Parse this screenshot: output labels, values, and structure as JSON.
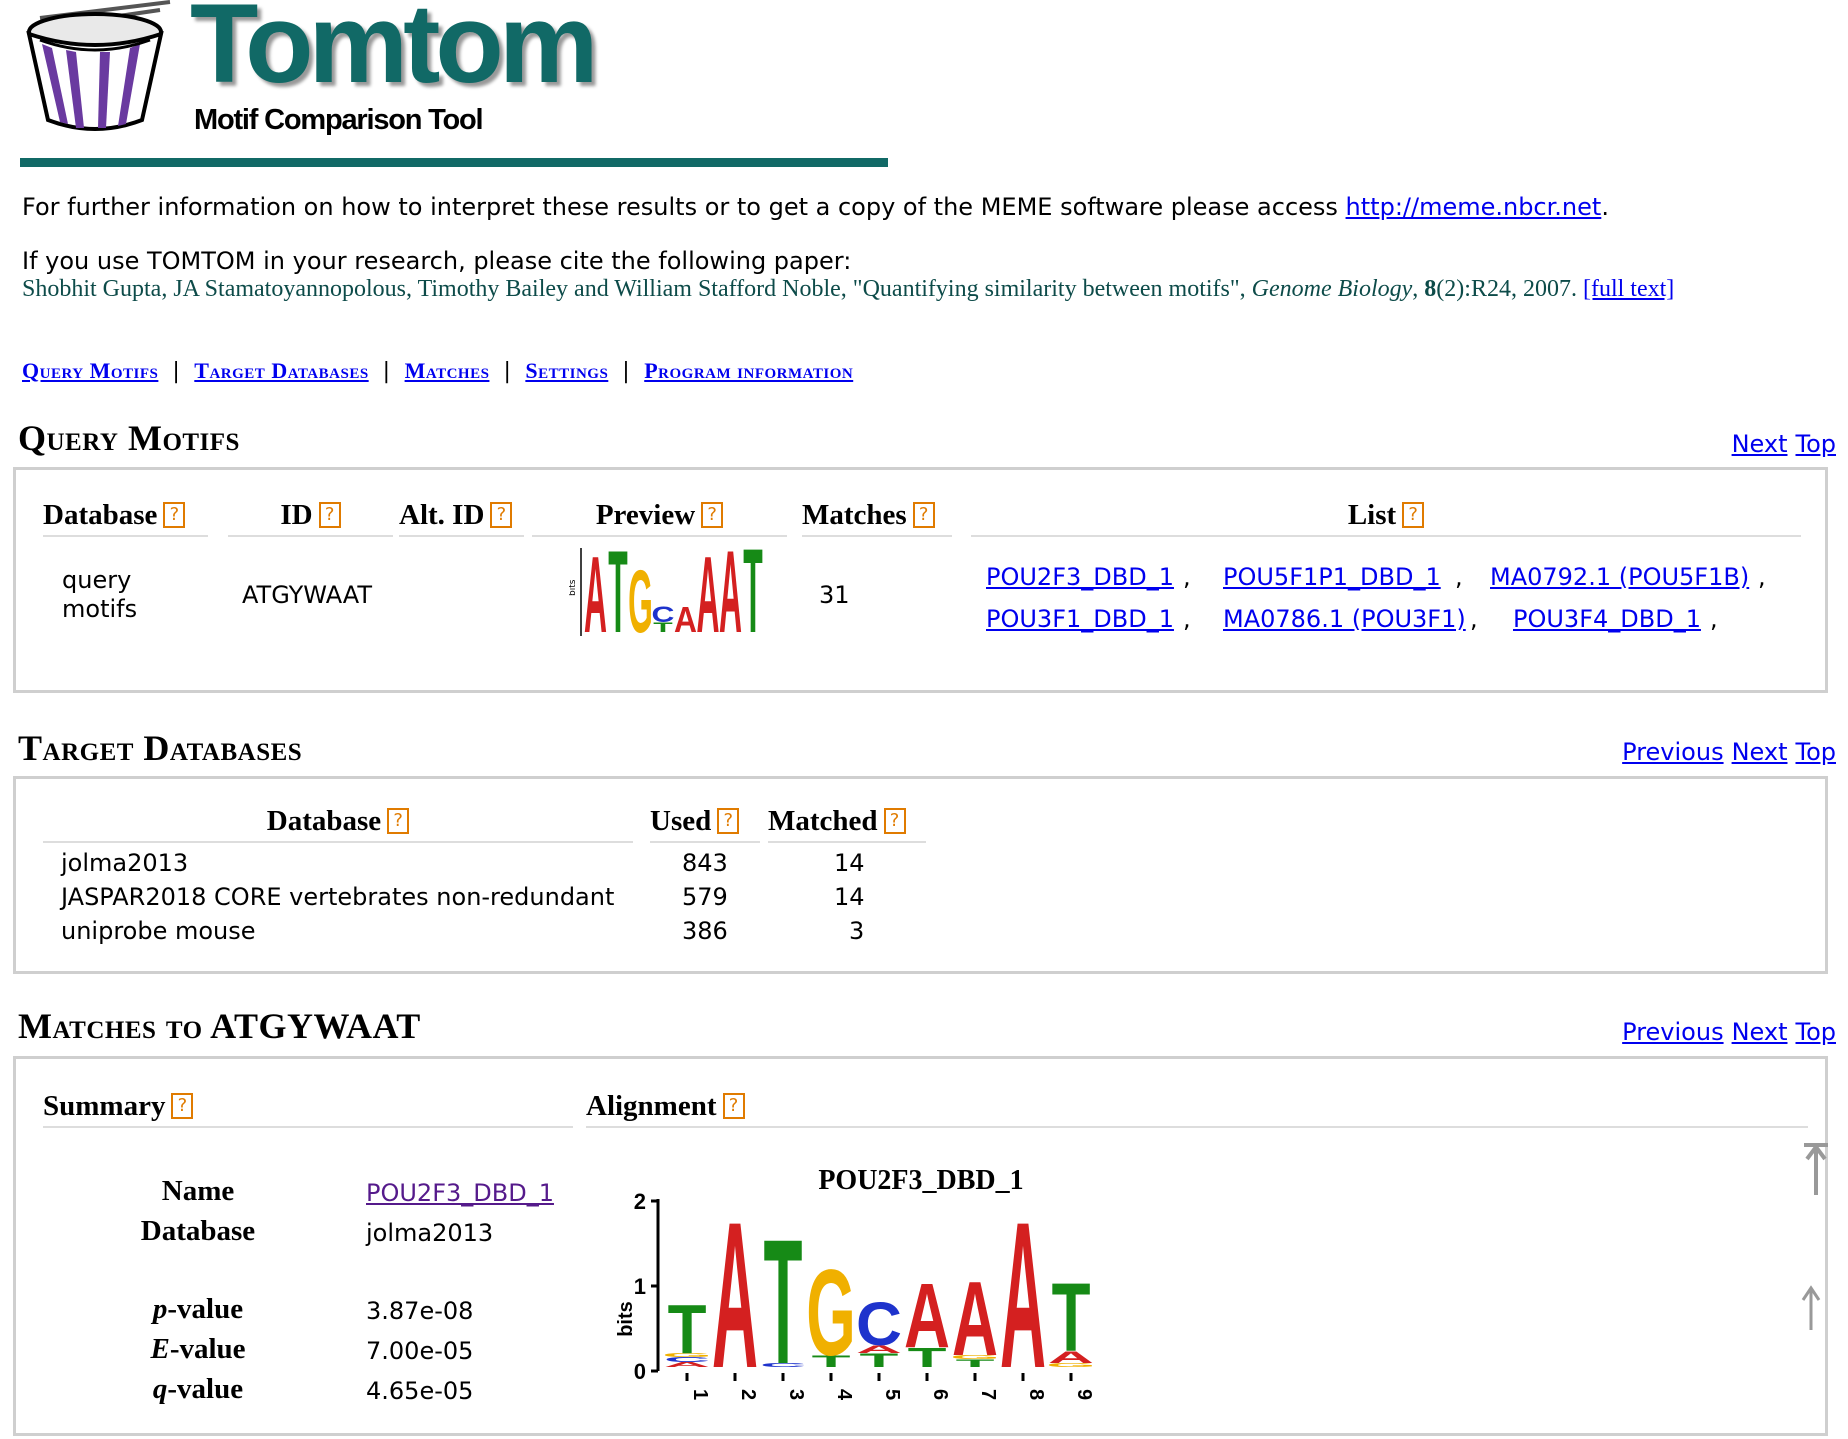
{
  "header": {
    "title": "Tomtom",
    "subtitle": "Motif Comparison Tool"
  },
  "intro": {
    "info_text": "For further information on how to interpret these results or to get a copy of the MEME software please access ",
    "info_link": "http://meme.nbcr.net",
    "info_end": ".",
    "cite_text": "If you use TOMTOM in your research, please cite the following paper:",
    "citation": {
      "authors": "Shobhit Gupta, JA Stamatoyannopolous, Timothy Bailey and William Stafford Noble, \"Quantifying similarity between motifs\", ",
      "journal": "Genome Biology",
      "sep": ", ",
      "volume": "8",
      "issue_pages": "(2):R24, 2007. ",
      "fulltext": "[full text]"
    }
  },
  "nav": {
    "items": [
      "Query Motifs",
      "Target Databases",
      "Matches",
      "Settings",
      "Program information"
    ],
    "separator": "|"
  },
  "query_motifs": {
    "title": "Query Motifs",
    "links": {
      "next": "Next",
      "top": "Top"
    },
    "headers": [
      "Database",
      "ID",
      "Alt. ID",
      "Preview",
      "Matches",
      "List"
    ],
    "row": {
      "database_line1": "query",
      "database_line2": "motifs",
      "id": "ATGYWAAT",
      "alt_id": "",
      "matches": "31",
      "list": [
        "POU2F3_DBD_1",
        "POU5F1P1_DBD_1",
        "MA0792.1 (POU5F1B)",
        "POU3F1_DBD_1",
        "MA0786.1 (POU3F1)",
        "POU3F4_DBD_1"
      ],
      "list_sep": ","
    }
  },
  "target_databases": {
    "title": "Target Databases",
    "links": {
      "previous": "Previous",
      "next": "Next",
      "top": "Top"
    },
    "headers": [
      "Database",
      "Used",
      "Matched"
    ],
    "rows": [
      {
        "database": "jolma2013",
        "used": "843",
        "matched": "14"
      },
      {
        "database": "JASPAR2018 CORE vertebrates non-redundant",
        "used": "579",
        "matched": "14"
      },
      {
        "database": "uniprobe mouse",
        "used": "386",
        "matched": "3"
      }
    ]
  },
  "matches": {
    "title": "Matches to ATGYWAAT",
    "links": {
      "previous": "Previous",
      "next": "Next",
      "top": "Top"
    },
    "headers": [
      "Summary",
      "Alignment"
    ],
    "summary": {
      "name_label": "Name",
      "name_value": "POU2F3_DBD_1",
      "database_label": "Database",
      "database_value": "jolma2013",
      "pvalue_label": "-value",
      "pvalue_prefix": "p",
      "pvalue": "3.87e-08",
      "evalue_label": "-value",
      "evalue_prefix": "E",
      "evalue": "7.00e-05",
      "qvalue_label": "-value",
      "qvalue_prefix": "q",
      "qvalue": "4.65e-05"
    },
    "logo": {
      "title": "POU2F3_DBD_1",
      "ylabel": "bits",
      "yticks": [
        "0",
        "1",
        "2"
      ],
      "positions": [
        "1",
        "2",
        "3",
        "4",
        "5",
        "6",
        "7",
        "8",
        "9"
      ]
    }
  },
  "preview_logo": {
    "letters": [
      "A",
      "T",
      "G",
      "C",
      "A",
      "A",
      "A",
      "T"
    ],
    "ylabel": "bits"
  },
  "colors": {
    "brand": "#116966",
    "link": "#0000ee",
    "help": "#e07b00",
    "A": "#d42020",
    "C": "#1e33cc",
    "G": "#f0b000",
    "T": "#168a16"
  }
}
